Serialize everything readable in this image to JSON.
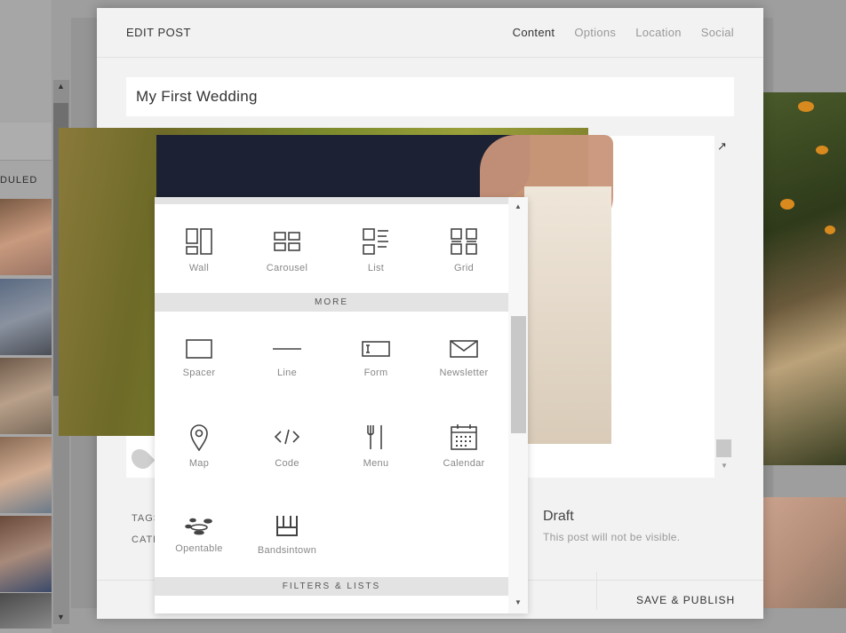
{
  "background": {
    "scheduled_label": "DULED"
  },
  "modal": {
    "title": "EDIT POST",
    "tabs": [
      {
        "label": "Content",
        "active": true
      },
      {
        "label": "Options",
        "active": false
      },
      {
        "label": "Location",
        "active": false
      },
      {
        "label": "Social",
        "active": false
      }
    ],
    "post_title_value": "My First Wedding",
    "meta_tags_label": "TAGS",
    "meta_categories_label": "CATE",
    "status": {
      "title": "Draft",
      "description": "This post will not be visible."
    },
    "save_button_label": "SAVE & PUBLISH"
  },
  "picker": {
    "sections": {
      "more": "MORE",
      "filters_lists": "FILTERS & LISTS"
    },
    "gallery_blocks": [
      {
        "label": "Wall",
        "icon": "wall-icon"
      },
      {
        "label": "Carousel",
        "icon": "carousel-icon"
      },
      {
        "label": "List",
        "icon": "list-icon"
      },
      {
        "label": "Grid",
        "icon": "grid-icon"
      }
    ],
    "more_blocks": [
      {
        "label": "Spacer",
        "icon": "spacer-icon"
      },
      {
        "label": "Line",
        "icon": "line-icon"
      },
      {
        "label": "Form",
        "icon": "form-icon"
      },
      {
        "label": "Newsletter",
        "icon": "envelope-icon"
      },
      {
        "label": "Map",
        "icon": "map-pin-icon"
      },
      {
        "label": "Code",
        "icon": "code-icon"
      },
      {
        "label": "Menu",
        "icon": "fork-knife-icon"
      },
      {
        "label": "Calendar",
        "icon": "calendar-icon"
      },
      {
        "label": "Opentable",
        "icon": "opentable-icon"
      },
      {
        "label": "Bandsintown",
        "icon": "bandsintown-icon"
      }
    ]
  },
  "colors": {
    "modal_bg": "#f2f2f2",
    "section_bar": "#e3e3e3",
    "text_dark": "#333333",
    "text_muted": "#999999"
  }
}
